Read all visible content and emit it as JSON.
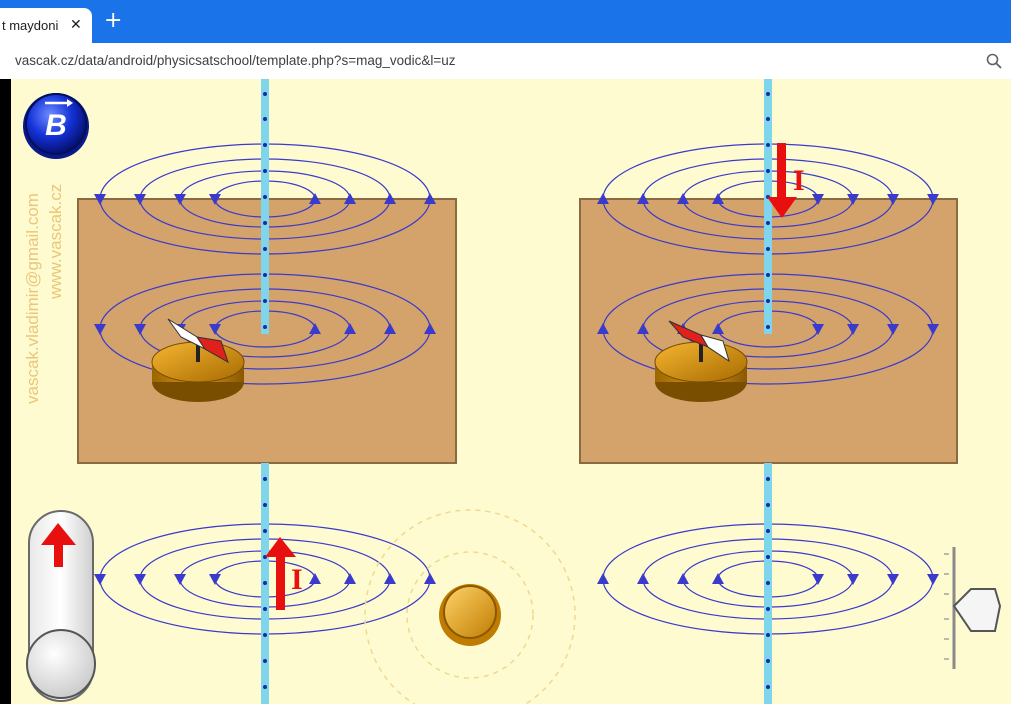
{
  "browser": {
    "tab_title": "t maydoni",
    "tab_close": "✕",
    "new_tab": "+",
    "url": "vascak.cz/data/android/physicsatschool/template.php?s=mag_vodic&l=uz",
    "zoom_icon": "magnifier-icon"
  },
  "simulation": {
    "b_button_label": "B",
    "watermark_email": "vascak.vladimir@gmail.com",
    "watermark_site": "www.vascak.cz",
    "current_label": "I",
    "colors": {
      "background": "#fffbd0",
      "plate": "#d4a36b",
      "field_line": "#3a3acc",
      "wire": "#7fd6ec",
      "arrow": "#e8100f"
    }
  }
}
